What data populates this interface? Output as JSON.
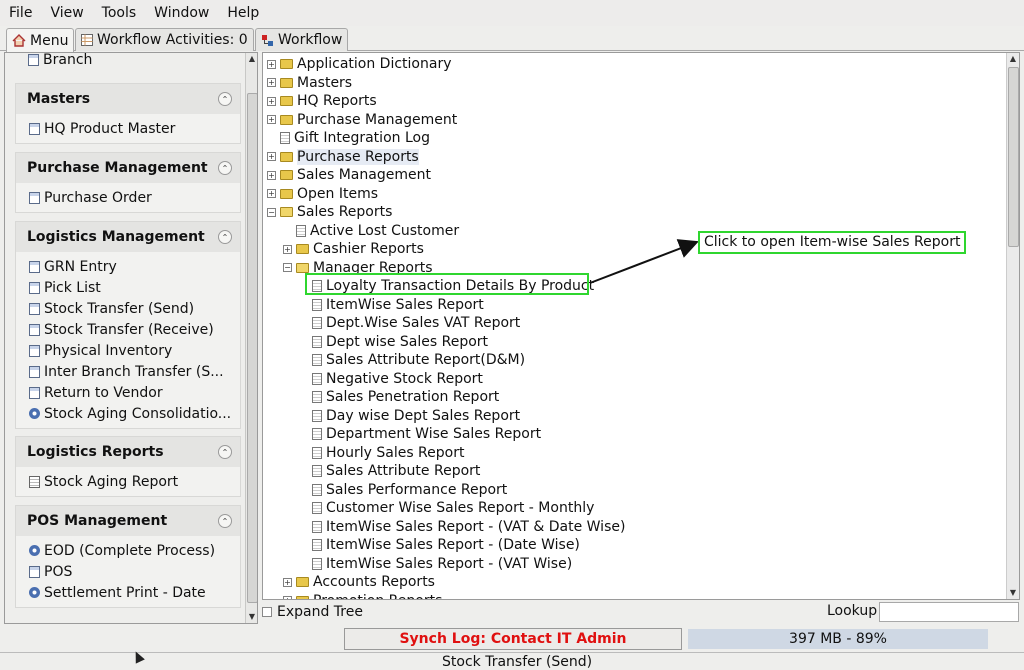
{
  "menubar": [
    "File",
    "View",
    "Tools",
    "Window",
    "Help"
  ],
  "tabs": [
    {
      "label": "Menu",
      "icon": "home-icon"
    },
    {
      "label": "Workflow Activities: 0",
      "icon": "table-icon"
    },
    {
      "label": "Workflow",
      "icon": "workflow-icon"
    }
  ],
  "left": {
    "partial_item": "Branch",
    "groups": [
      {
        "title": "Masters",
        "items": [
          {
            "label": "HQ Product Master",
            "icon": "doc"
          }
        ]
      },
      {
        "title": "Purchase Management",
        "items": [
          {
            "label": "Purchase Order",
            "icon": "doc"
          }
        ]
      },
      {
        "title": "Logistics Management",
        "items": [
          {
            "label": "GRN Entry",
            "icon": "doc"
          },
          {
            "label": "Pick List",
            "icon": "doc"
          },
          {
            "label": "Stock Transfer (Send)",
            "icon": "doc"
          },
          {
            "label": "Stock Transfer (Receive)",
            "icon": "doc"
          },
          {
            "label": "Physical Inventory",
            "icon": "doc"
          },
          {
            "label": "Inter Branch Transfer (S...",
            "icon": "doc"
          },
          {
            "label": "Return to Vendor",
            "icon": "doc"
          },
          {
            "label": "Stock Aging Consolidatio...",
            "icon": "gear"
          }
        ]
      },
      {
        "title": "Logistics Reports",
        "items": [
          {
            "label": "Stock Aging Report",
            "icon": "sheet"
          }
        ]
      },
      {
        "title": "POS Management",
        "items": [
          {
            "label": "EOD (Complete Process)",
            "icon": "gear"
          },
          {
            "label": "POS",
            "icon": "doc"
          },
          {
            "label": "Settlement Print - Date",
            "icon": "gear"
          }
        ]
      }
    ]
  },
  "tree": {
    "nodes": [
      {
        "label": "Application Dictionary",
        "level": 0,
        "type": "folder",
        "toggle": "+"
      },
      {
        "label": "Masters",
        "level": 0,
        "type": "folder",
        "toggle": "+"
      },
      {
        "label": "HQ Reports",
        "level": 0,
        "type": "folder",
        "toggle": "+"
      },
      {
        "label": "Purchase Management",
        "level": 0,
        "type": "folder",
        "toggle": "+"
      },
      {
        "label": "Gift Integration Log",
        "level": 0,
        "type": "doc",
        "toggle": ""
      },
      {
        "label": "Purchase Reports",
        "level": 0,
        "type": "folder",
        "toggle": "+",
        "selected": true
      },
      {
        "label": "Sales Management",
        "level": 0,
        "type": "folder",
        "toggle": "+"
      },
      {
        "label": "Open Items",
        "level": 0,
        "type": "folder",
        "toggle": "+"
      },
      {
        "label": "Sales Reports",
        "level": 0,
        "type": "folder-open",
        "toggle": "-"
      },
      {
        "label": "Active Lost Customer",
        "level": 1,
        "type": "doc",
        "toggle": ""
      },
      {
        "label": "Cashier Reports",
        "level": 1,
        "type": "folder",
        "toggle": "+"
      },
      {
        "label": "Manager Reports",
        "level": 1,
        "type": "folder-open",
        "toggle": "-"
      },
      {
        "label": "Loyalty Transaction Details By Product",
        "level": 2,
        "type": "doc",
        "toggle": "",
        "highlight": true
      },
      {
        "label": "ItemWise Sales Report",
        "level": 2,
        "type": "doc",
        "toggle": ""
      },
      {
        "label": "Dept.Wise Sales VAT Report",
        "level": 2,
        "type": "doc",
        "toggle": ""
      },
      {
        "label": "Dept wise Sales Report",
        "level": 2,
        "type": "doc",
        "toggle": ""
      },
      {
        "label": "Sales Attribute Report(D&M)",
        "level": 2,
        "type": "doc",
        "toggle": ""
      },
      {
        "label": "Negative Stock Report",
        "level": 2,
        "type": "doc",
        "toggle": ""
      },
      {
        "label": "Sales Penetration Report",
        "level": 2,
        "type": "doc",
        "toggle": ""
      },
      {
        "label": "Day wise Dept Sales Report",
        "level": 2,
        "type": "doc",
        "toggle": ""
      },
      {
        "label": "Department Wise Sales Report",
        "level": 2,
        "type": "doc",
        "toggle": ""
      },
      {
        "label": "Hourly Sales Report",
        "level": 2,
        "type": "doc",
        "toggle": ""
      },
      {
        "label": "Sales Attribute Report",
        "level": 2,
        "type": "doc",
        "toggle": ""
      },
      {
        "label": "Sales Performance Report",
        "level": 2,
        "type": "doc",
        "toggle": ""
      },
      {
        "label": "Customer Wise Sales Report - Monthly",
        "level": 2,
        "type": "doc",
        "toggle": ""
      },
      {
        "label": "ItemWise Sales Report - (VAT & Date Wise)",
        "level": 2,
        "type": "doc",
        "toggle": ""
      },
      {
        "label": "ItemWise Sales Report - (Date Wise)",
        "level": 2,
        "type": "doc",
        "toggle": ""
      },
      {
        "label": "ItemWise Sales Report - (VAT Wise)",
        "level": 2,
        "type": "doc",
        "toggle": ""
      },
      {
        "label": "Accounts Reports",
        "level": 1,
        "type": "folder",
        "toggle": "+"
      },
      {
        "label": "Promotion Reports",
        "level": 1,
        "type": "folder",
        "toggle": "+"
      }
    ],
    "callout": "Click to open Item-wise Sales Report",
    "expand_tree": "Expand Tree",
    "lookup_label": "Lookup",
    "lookup_value": ""
  },
  "status": {
    "synch": "Synch Log: Contact IT Admin",
    "memory": "397 MB - 89%",
    "footer": "Stock Transfer (Send)"
  },
  "colors": {
    "highlight": "#2fd62f",
    "synch_text": "#e01010",
    "memory_bg": "#cfd8e4"
  }
}
